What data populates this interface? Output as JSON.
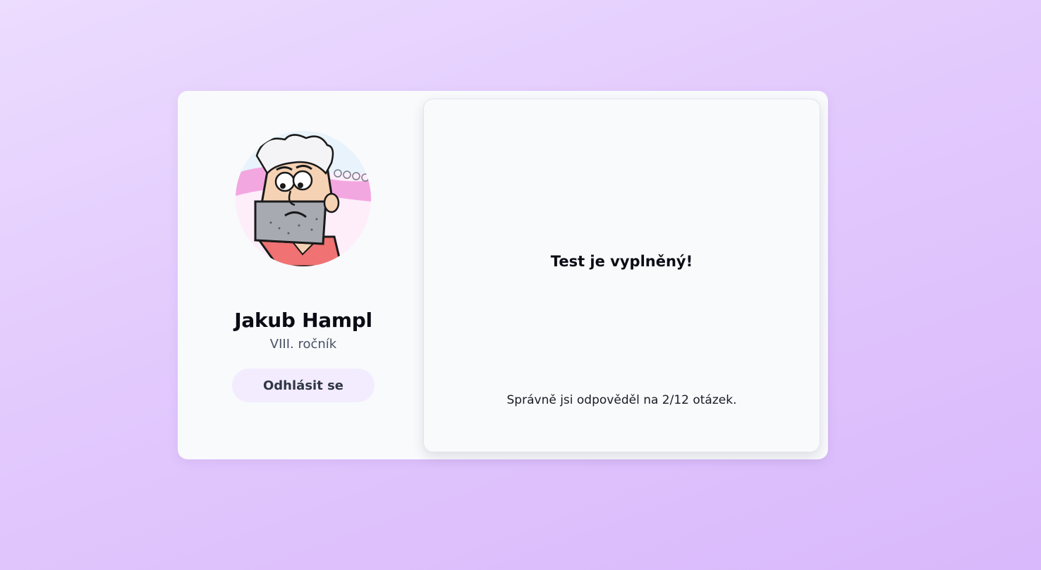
{
  "profile": {
    "name": "Jakub Hampl",
    "grade": "VIII. ročník",
    "logout_label": "Odhlásit se",
    "avatar_icon": "cartoon-avatar-icon"
  },
  "result": {
    "title": "Test je vyplněný!",
    "score_text": "Správně jsi odpověděl na 2/12 otázek."
  },
  "colors": {
    "background": "#e4cdfd",
    "card": "#f8fafc",
    "button": "#f3ecfe"
  }
}
